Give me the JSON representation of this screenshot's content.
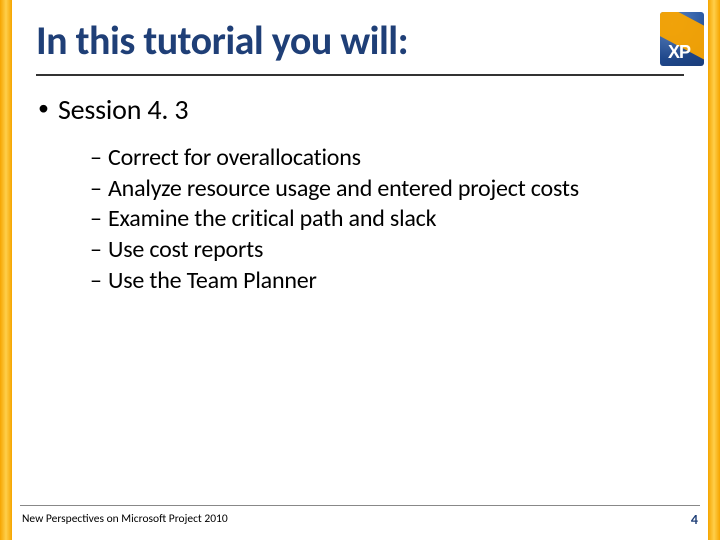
{
  "title": "In this tutorial you will:",
  "session_label": "Session 4. 3",
  "sub_items": [
    "Correct for overallocations",
    "Analyze resource usage and entered project costs",
    "Examine the critical path and slack",
    "Use cost reports",
    "Use the Team Planner"
  ],
  "footer": "New Perspectives on Microsoft Project 2010",
  "page_number": "4",
  "badge_text": "XP"
}
